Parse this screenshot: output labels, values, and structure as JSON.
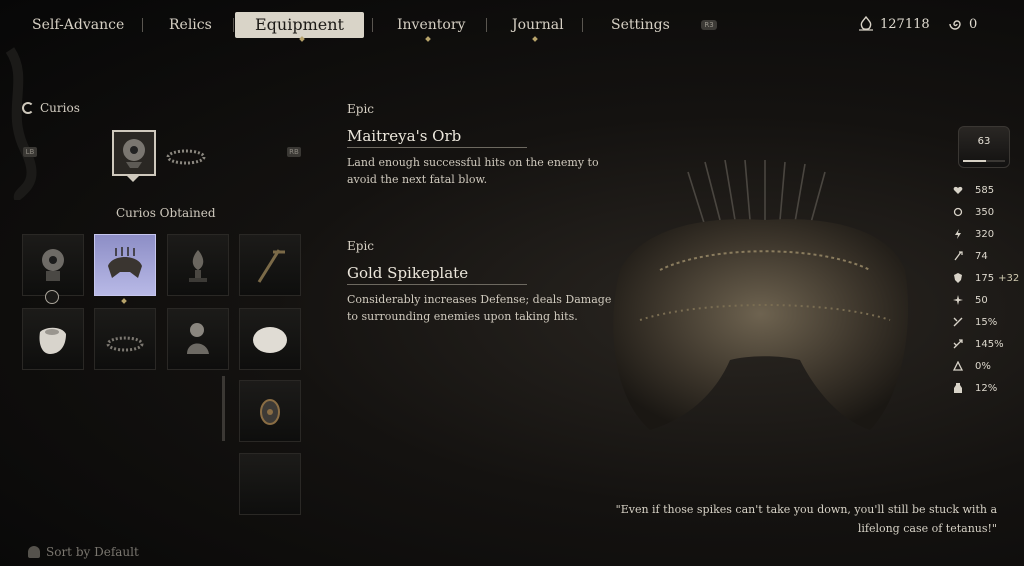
{
  "nav": {
    "tabs": [
      {
        "label": "Self-Advance",
        "active": false
      },
      {
        "label": "Relics",
        "active": false
      },
      {
        "label": "Equipment",
        "active": true
      },
      {
        "label": "Inventory",
        "active": false
      },
      {
        "label": "Journal",
        "active": false
      },
      {
        "label": "Settings",
        "active": false
      }
    ],
    "key_hint": "R3",
    "currency_a": "127118",
    "currency_b": "0"
  },
  "left": {
    "section_title": "Curios",
    "prev_key": "LB",
    "next_key": "RB",
    "obtained_title": "Curios Obtained",
    "sort_label": "Sort by Default"
  },
  "items": [
    {
      "rarity": "Epic",
      "name": "Maitreya's Orb",
      "description": "Land enough successful hits on the enemy to avoid the next fatal blow."
    },
    {
      "rarity": "Epic",
      "name": "Gold Spikeplate",
      "description": "Considerably increases Defense; deals Damage to surrounding enemies upon taking hits."
    }
  ],
  "stats": {
    "level": "63",
    "level_progress": 0.55,
    "rows": [
      {
        "icon": "heart-icon",
        "value": "585",
        "bonus": ""
      },
      {
        "icon": "mana-icon",
        "value": "350",
        "bonus": ""
      },
      {
        "icon": "stamina-icon",
        "value": "320",
        "bonus": ""
      },
      {
        "icon": "attack-icon",
        "value": "74",
        "bonus": ""
      },
      {
        "icon": "defense-icon",
        "value": "175",
        "bonus": "+32"
      },
      {
        "icon": "focus-icon",
        "value": "50",
        "bonus": ""
      },
      {
        "icon": "crit-chance-icon",
        "value": "15%",
        "bonus": ""
      },
      {
        "icon": "crit-damage-icon",
        "value": "145%",
        "bonus": ""
      },
      {
        "icon": "resist-icon",
        "value": "0%",
        "bonus": ""
      },
      {
        "icon": "flask-icon",
        "value": "12%",
        "bonus": ""
      }
    ]
  },
  "quote": "\"Even if those spikes can't take you down, you'll still be stuck with a lifelong case of tetanus!\""
}
